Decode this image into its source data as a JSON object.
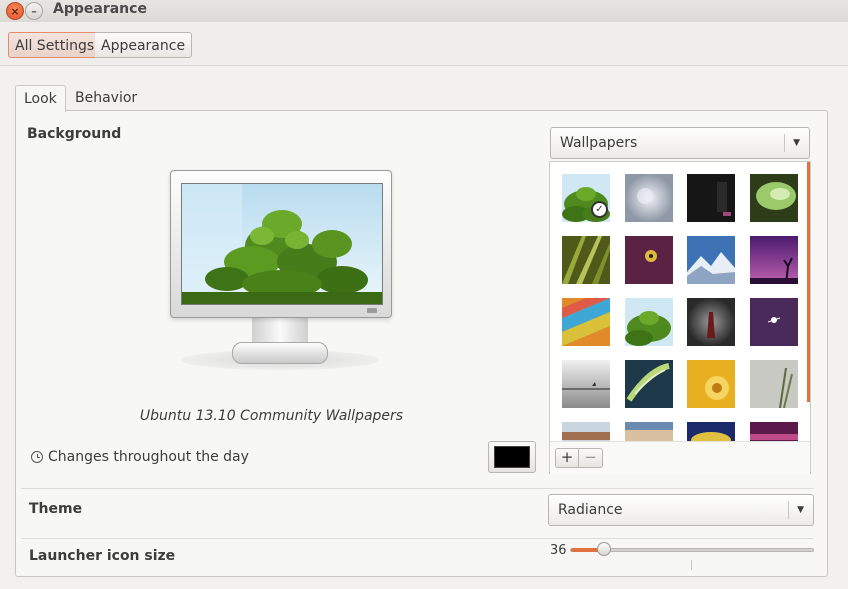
{
  "window": {
    "title": "Appearance"
  },
  "toolbar": {
    "all_settings": "All Settings",
    "appearance": "Appearance"
  },
  "tabs": [
    {
      "label": "Look",
      "active": true
    },
    {
      "label": "Behavior",
      "active": false
    }
  ],
  "background": {
    "label": "Background",
    "caption": "Ubuntu 13.10 Community Wallpapers",
    "changes_text": "Changes throughout the day",
    "color_button": "#000000",
    "source_select": "Wallpapers"
  },
  "wallpapers": [
    {
      "name": "green-leaves",
      "selected": true
    },
    {
      "name": "frost-bubble",
      "selected": false
    },
    {
      "name": "dark-scene",
      "selected": false
    },
    {
      "name": "green-leaf-macro",
      "selected": false
    },
    {
      "name": "grass-blades",
      "selected": false
    },
    {
      "name": "ladybug",
      "selected": false
    },
    {
      "name": "snowy-mountains",
      "selected": false
    },
    {
      "name": "purple-sunset-tree",
      "selected": false
    },
    {
      "name": "colorful-wall",
      "selected": false
    },
    {
      "name": "green-leaves-2",
      "selected": false
    },
    {
      "name": "dark-object",
      "selected": false
    },
    {
      "name": "purple-flower",
      "selected": false
    },
    {
      "name": "foggy-sea",
      "selected": false
    },
    {
      "name": "fern",
      "selected": false
    },
    {
      "name": "yellow-flower",
      "selected": false
    },
    {
      "name": "grey-grass",
      "selected": false
    },
    {
      "name": "sky-horizon",
      "selected": false
    },
    {
      "name": "sunset-clouds",
      "selected": false
    },
    {
      "name": "blue-yellow",
      "selected": false
    },
    {
      "name": "purple-pink",
      "selected": false
    }
  ],
  "grid_buttons": {
    "add": "+",
    "remove": "−"
  },
  "theme": {
    "label": "Theme",
    "value": "Radiance"
  },
  "launcher": {
    "label": "Launcher icon size",
    "value": "36",
    "fraction": 0.14
  },
  "accent": "#e0723f"
}
